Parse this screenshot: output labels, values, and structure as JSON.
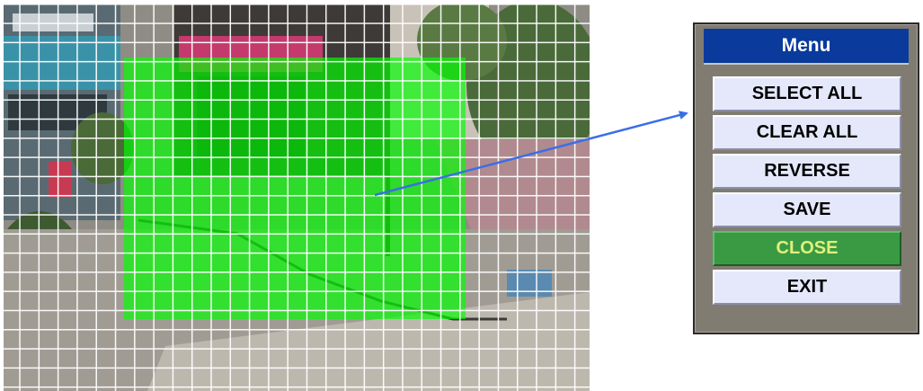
{
  "menu": {
    "title": "Menu",
    "items": [
      {
        "id": "select-all",
        "label": "SELECT ALL",
        "selected": false
      },
      {
        "id": "clear-all",
        "label": "CLEAR ALL",
        "selected": false
      },
      {
        "id": "reverse",
        "label": "REVERSE",
        "selected": false
      },
      {
        "id": "save",
        "label": "SAVE",
        "selected": false
      },
      {
        "id": "close",
        "label": "CLOSE",
        "selected": true
      },
      {
        "id": "exit",
        "label": "EXIT",
        "selected": false
      }
    ]
  },
  "colors": {
    "motion_region": "#00ff00",
    "grid_line": "#ffffff",
    "menu_title_bg": "#0a3a9c",
    "menu_item_bg": "#e4e8fa",
    "menu_item_selected_bg": "#3a9a44",
    "menu_item_selected_text": "#e0f07a",
    "arrow": "#3a6ee8"
  },
  "icons": {
    "arrow": "arrow-pointer-icon"
  }
}
